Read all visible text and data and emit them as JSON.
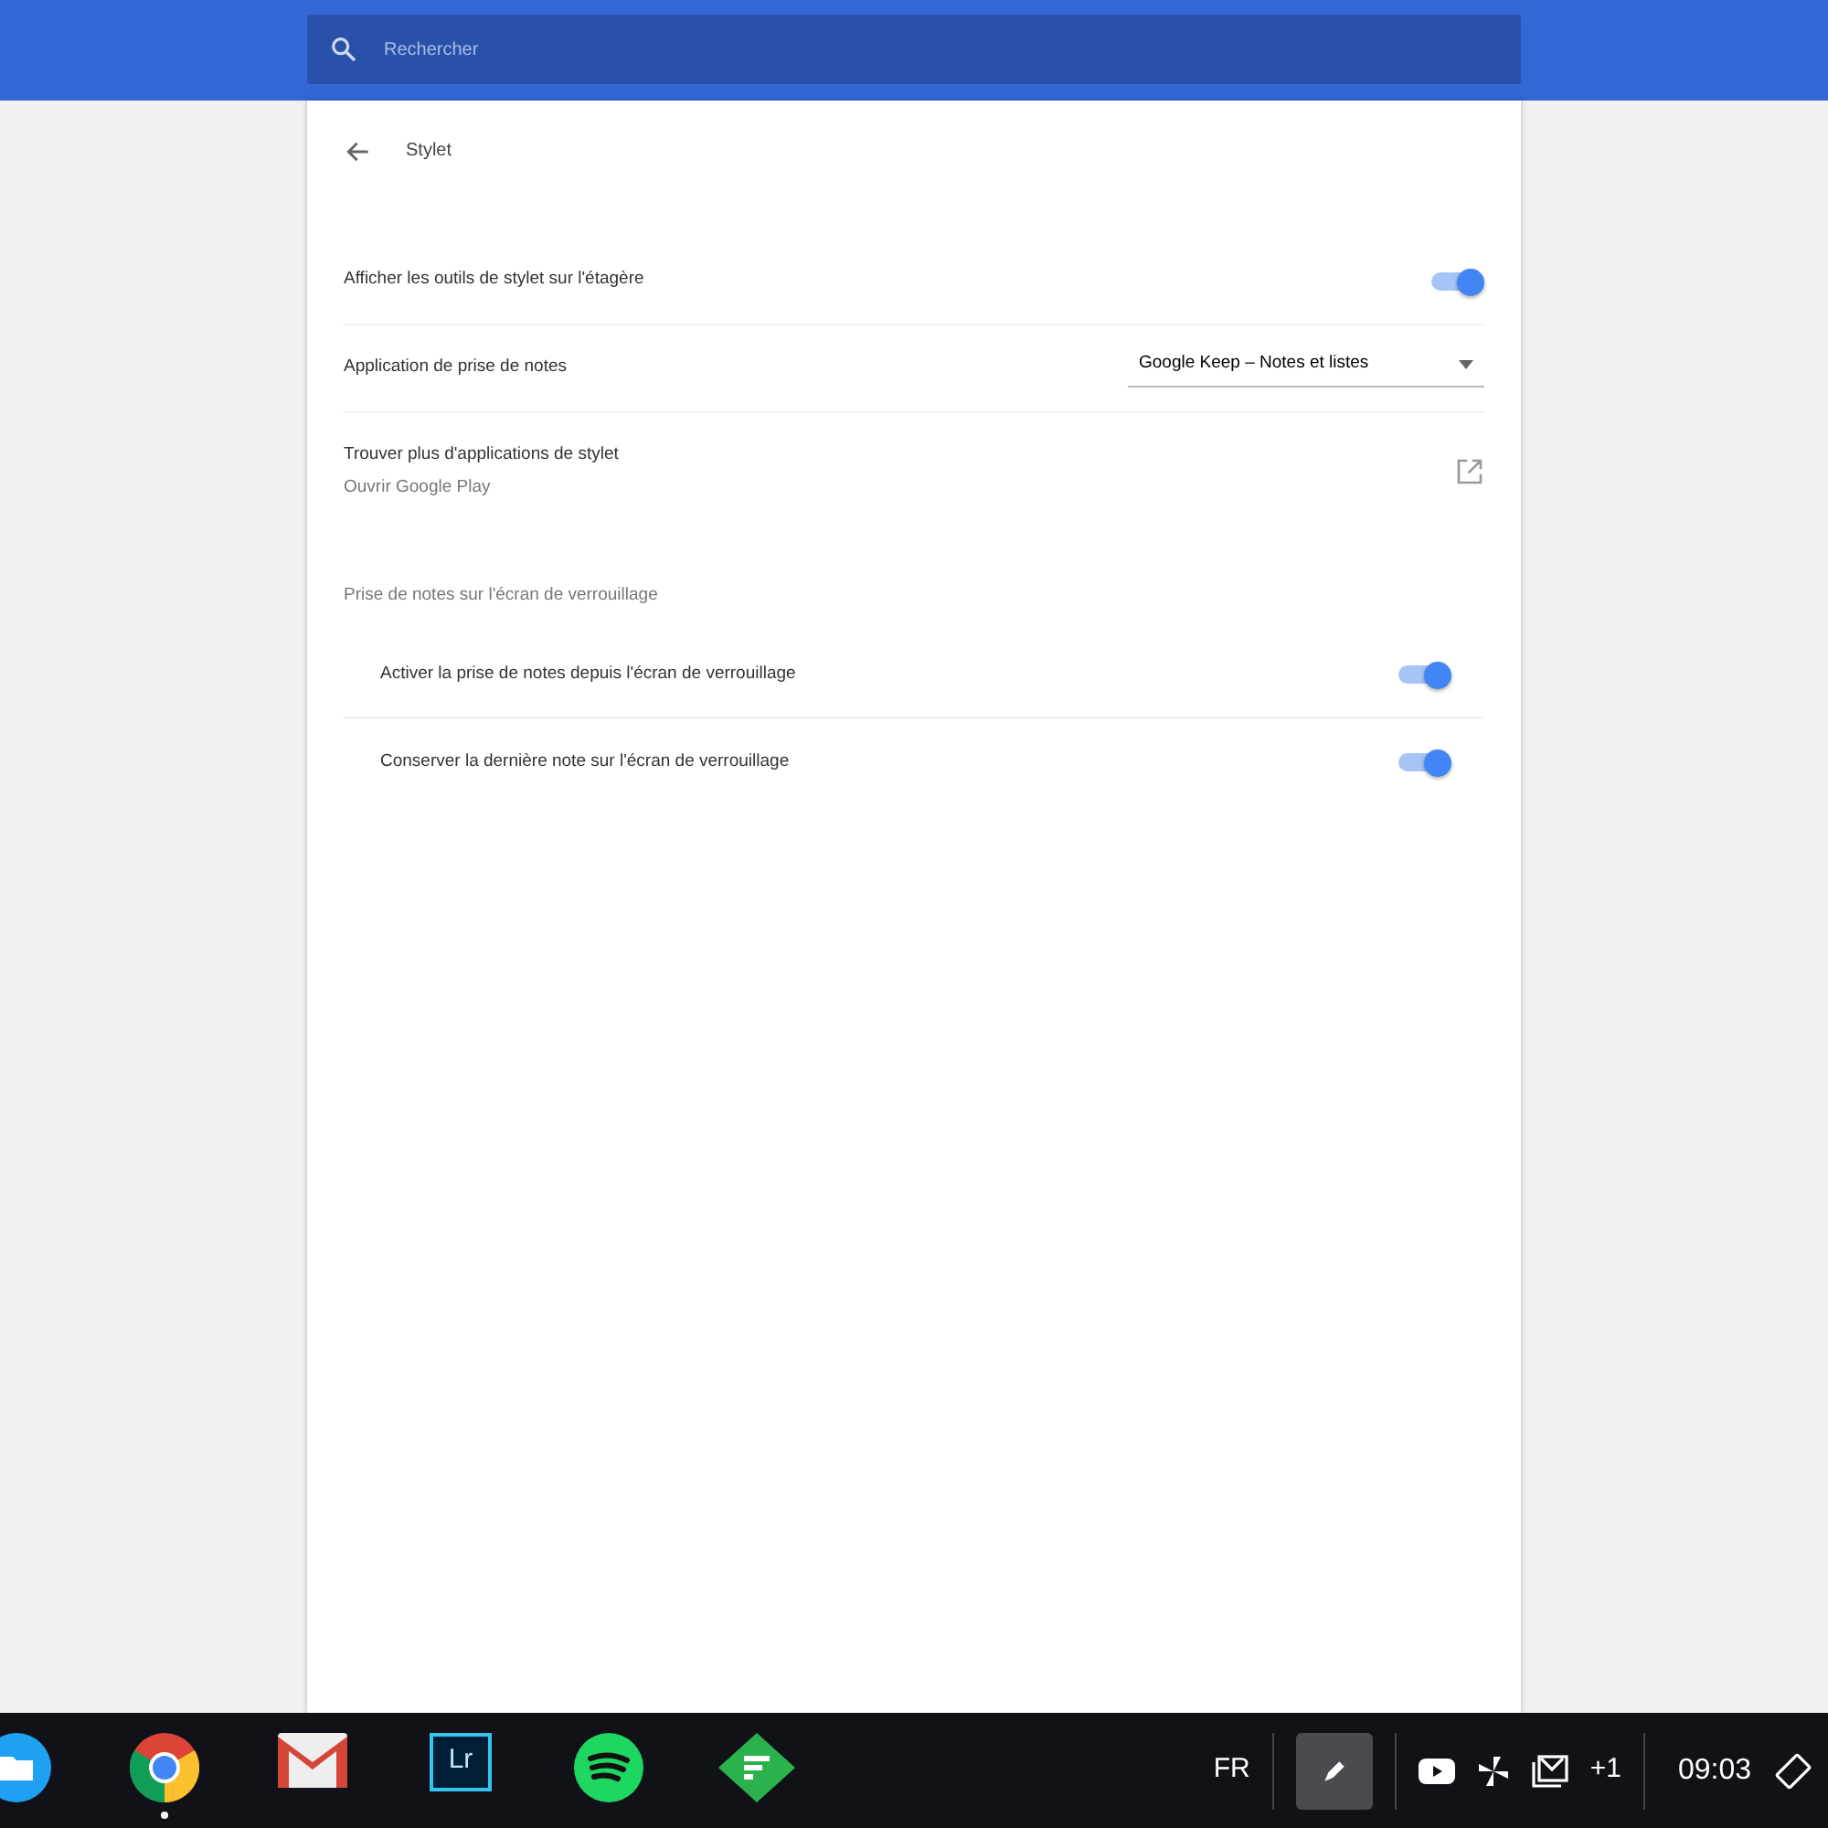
{
  "search": {
    "placeholder": "Rechercher"
  },
  "page": {
    "title": "Stylet"
  },
  "settings": [
    {
      "kind": "toggle",
      "label": "Afficher les outils de stylet sur l'étagère",
      "on": true
    },
    {
      "kind": "dropdown",
      "label": "Application de prise de notes",
      "value": "Google Keep – Notes et listes"
    },
    {
      "kind": "link",
      "label": "Trouver plus d'applications de stylet",
      "sublabel": "Ouvrir Google Play"
    }
  ],
  "lock_screen": {
    "heading": "Prise de notes sur l'écran de verrouillage",
    "items": [
      {
        "label": "Activer la prise de notes depuis l'écran de verrouillage",
        "on": true
      },
      {
        "label": "Conserver la dernière note sur l'écran de verrouillage",
        "on": true
      }
    ]
  },
  "shelf": {
    "apps": [
      {
        "kind": "files",
        "running": false
      },
      {
        "kind": "chrome",
        "running": true
      },
      {
        "kind": "mail",
        "running": false
      },
      {
        "kind": "lr",
        "label": "Lr",
        "running": false
      },
      {
        "kind": "music",
        "running": false
      },
      {
        "kind": "feed",
        "running": false
      }
    ],
    "language": "FR",
    "stylus_selected": true,
    "more_notifications": "+1",
    "time": "09:03"
  }
}
